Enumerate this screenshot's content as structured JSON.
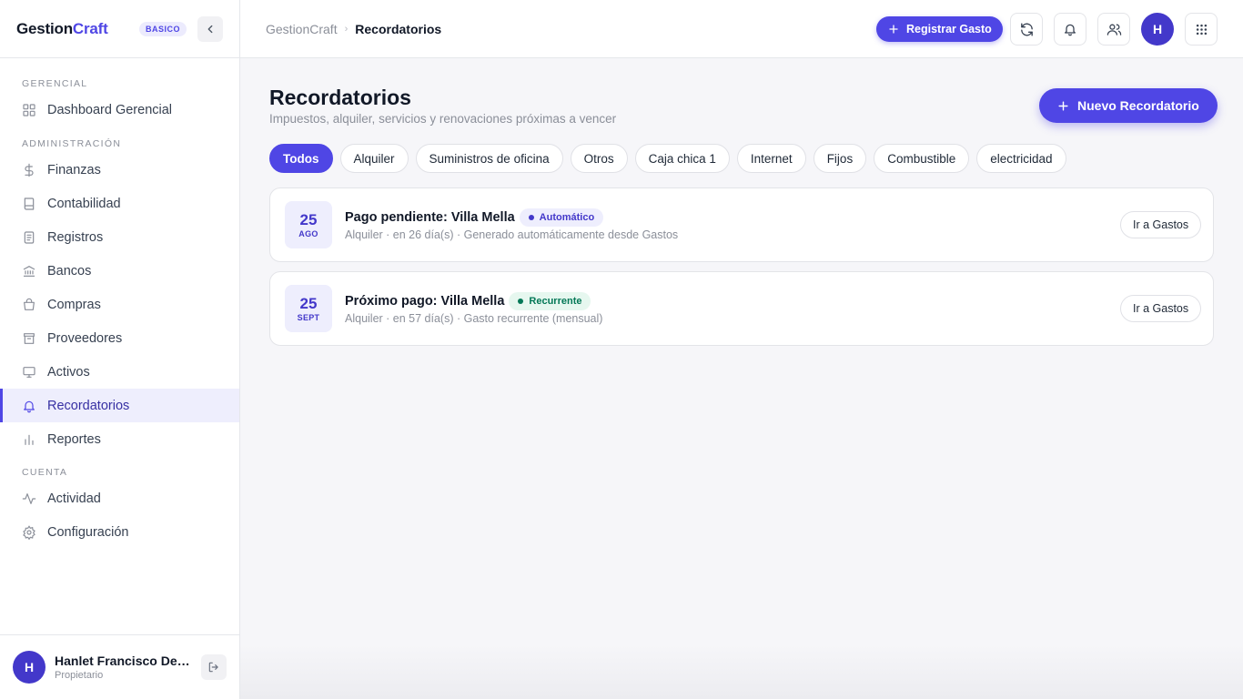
{
  "brand": {
    "name_part1": "Gestion",
    "name_part2": "Craft",
    "plan": "BASICO"
  },
  "colors": {
    "accent": "#4f46e5",
    "accent_dark": "#4338ca",
    "success": "#047857",
    "muted": "#8b8f99"
  },
  "sidebar": {
    "sections": [
      {
        "title": "GERENCIAL",
        "items": [
          {
            "label": "Dashboard Gerencial",
            "icon": "grid-icon"
          }
        ]
      },
      {
        "title": "ADMINISTRACIÓN",
        "items": [
          {
            "label": "Finanzas",
            "icon": "dollar-icon"
          },
          {
            "label": "Contabilidad",
            "icon": "book-icon"
          },
          {
            "label": "Registros",
            "icon": "file-text-icon"
          },
          {
            "label": "Bancos",
            "icon": "bank-icon"
          },
          {
            "label": "Compras",
            "icon": "basket-icon"
          },
          {
            "label": "Proveedores",
            "icon": "store-icon"
          },
          {
            "label": "Activos",
            "icon": "monitor-icon"
          },
          {
            "label": "Recordatorios",
            "icon": "bell-icon",
            "active": true
          },
          {
            "label": "Reportes",
            "icon": "bar-chart-icon"
          }
        ]
      },
      {
        "title": "CUENTA",
        "items": [
          {
            "label": "Actividad",
            "icon": "activity-icon"
          },
          {
            "label": "Configuración",
            "icon": "gear-icon"
          }
        ]
      }
    ],
    "user": {
      "initial": "H",
      "name": "Hanlet Francisco De L...",
      "role": "Propietario"
    }
  },
  "header": {
    "breadcrumb_root": "GestionCraft",
    "breadcrumb_sep": "›",
    "breadcrumb_current": "Recordatorios",
    "register_expense_label": "Registrar Gasto",
    "avatar_initial": "H"
  },
  "main": {
    "title": "Recordatorios",
    "subtitle": "Impuestos, alquiler, servicios y renovaciones próximas a vencer",
    "new_button_label": "Nuevo Recordatorio",
    "filters": [
      "Todos",
      "Alquiler",
      "Suministros de oficina",
      "Otros",
      "Caja chica 1",
      "Internet",
      "Fijos",
      "Combustible",
      "electricidad"
    ],
    "active_filter": "Todos",
    "reminders": [
      {
        "day": "25",
        "month": "AGO",
        "title": "Pago pendiente: Villa Mella",
        "tag": "Automático",
        "tag_type": "auto",
        "meta": "Alquiler · en 26 día(s) · Generado automáticamente desde Gastos",
        "action": "Ir a Gastos"
      },
      {
        "day": "25",
        "month": "SEPT",
        "title": "Próximo pago: Villa Mella",
        "tag": "Recurrente",
        "tag_type": "rec",
        "meta": "Alquiler · en 57 día(s) · Gasto recurrente (mensual)",
        "action": "Ir a Gastos"
      }
    ]
  }
}
